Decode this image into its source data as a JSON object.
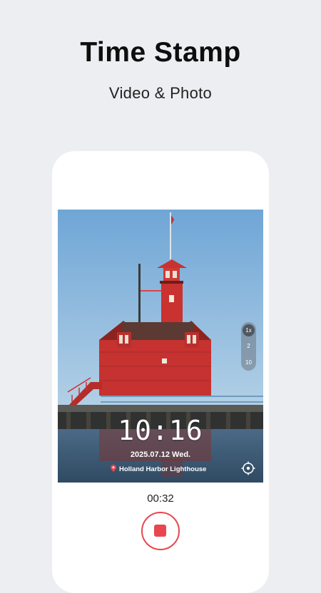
{
  "header": {
    "title": "Time Stamp",
    "subtitle": "Video & Photo"
  },
  "camera": {
    "zoom_options": [
      "1x",
      "2",
      "10"
    ],
    "selected_zoom": "1x",
    "stamp_time": "10:16",
    "stamp_date": "2025.07.12 Wed.",
    "stamp_location": "Holland Harbor Lighthouse"
  },
  "recording": {
    "elapsed": "00:32"
  },
  "colors": {
    "background": "#eceef1",
    "record_red": "#e8474f",
    "lighthouse_red": "#c42f2d",
    "sky": "#7fb0d8"
  },
  "icons": {
    "pin": "map-pin-icon",
    "locate": "crosshair-icon",
    "record": "stop-record-icon"
  }
}
